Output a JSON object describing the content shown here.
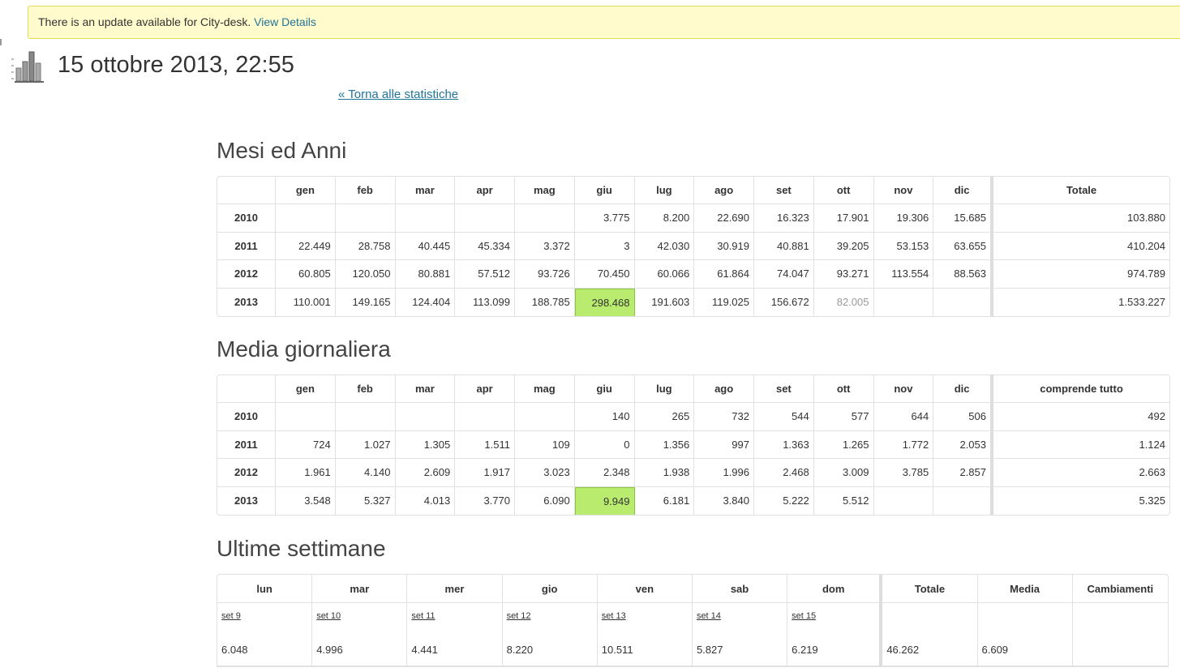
{
  "notice": {
    "text": "There is an update available for City-desk.",
    "link": "View Details"
  },
  "page": {
    "title": "15 ottobre 2013, 22:55",
    "back_link": "« Torna alle statistiche"
  },
  "icons": {
    "page_icon": "stats-chart-icon"
  },
  "months_table": {
    "heading": "Mesi ed Anni",
    "columns": [
      "gen",
      "feb",
      "mar",
      "apr",
      "mag",
      "giu",
      "lug",
      "ago",
      "set",
      "ott",
      "nov",
      "dic"
    ],
    "total_label": "Totale",
    "rows": [
      {
        "year": "2010",
        "values": [
          "",
          "",
          "",
          "",
          "",
          "3.775",
          "8.200",
          "22.690",
          "16.323",
          "17.901",
          "19.306",
          "15.685"
        ],
        "total": "103.880"
      },
      {
        "year": "2011",
        "values": [
          "22.449",
          "28.758",
          "40.445",
          "45.334",
          "3.372",
          "3",
          "42.030",
          "30.919",
          "40.881",
          "39.205",
          "53.153",
          "63.655"
        ],
        "total": "410.204"
      },
      {
        "year": "2012",
        "values": [
          "60.805",
          "120.050",
          "80.881",
          "57.512",
          "93.726",
          "70.450",
          "60.066",
          "61.864",
          "74.047",
          "93.271",
          "113.554",
          "88.563"
        ],
        "total": "974.789"
      },
      {
        "year": "2013",
        "values": [
          "110.001",
          "149.165",
          "124.404",
          "113.099",
          "188.785",
          "298.468",
          "191.603",
          "119.025",
          "156.672",
          "82.005",
          "",
          ""
        ],
        "total": "1.533.227"
      }
    ]
  },
  "daily_table": {
    "heading": "Media giornaliera",
    "columns": [
      "gen",
      "feb",
      "mar",
      "apr",
      "mag",
      "giu",
      "lug",
      "ago",
      "set",
      "ott",
      "nov",
      "dic"
    ],
    "total_label": "comprende tutto",
    "rows": [
      {
        "year": "2010",
        "values": [
          "",
          "",
          "",
          "",
          "",
          "140",
          "265",
          "732",
          "544",
          "577",
          "644",
          "506"
        ],
        "total": "492"
      },
      {
        "year": "2011",
        "values": [
          "724",
          "1.027",
          "1.305",
          "1.511",
          "109",
          "0",
          "1.356",
          "997",
          "1.363",
          "1.265",
          "1.772",
          "2.053"
        ],
        "total": "1.124"
      },
      {
        "year": "2012",
        "values": [
          "1.961",
          "4.140",
          "2.609",
          "1.917",
          "3.023",
          "2.348",
          "1.938",
          "1.996",
          "2.468",
          "3.009",
          "3.785",
          "2.857"
        ],
        "total": "2.663"
      },
      {
        "year": "2013",
        "values": [
          "3.548",
          "5.327",
          "4.013",
          "3.770",
          "6.090",
          "9.949",
          "6.181",
          "3.840",
          "5.222",
          "5.512",
          "",
          ""
        ],
        "total": "5.325"
      }
    ]
  },
  "weeks_table": {
    "heading": "Ultime settimane",
    "columns": [
      "lun",
      "mar",
      "mer",
      "gio",
      "ven",
      "sab",
      "dom"
    ],
    "summary_columns": [
      "Totale",
      "Media",
      "Cambiamenti"
    ],
    "row": {
      "days": [
        {
          "date": "set 9",
          "value": "6.048"
        },
        {
          "date": "set 10",
          "value": "4.996"
        },
        {
          "date": "set 11",
          "value": "4.441"
        },
        {
          "date": "set 12",
          "value": "8.220"
        },
        {
          "date": "set 13",
          "value": "10.511"
        },
        {
          "date": "set 14",
          "value": "5.827"
        },
        {
          "date": "set 15",
          "value": "6.219"
        }
      ],
      "total": "46.262",
      "average": "6.609",
      "change": ""
    }
  },
  "colors": {
    "highlight": "#b8eb6e",
    "notice_bg": "#fffbcc",
    "link": "#21759b"
  }
}
